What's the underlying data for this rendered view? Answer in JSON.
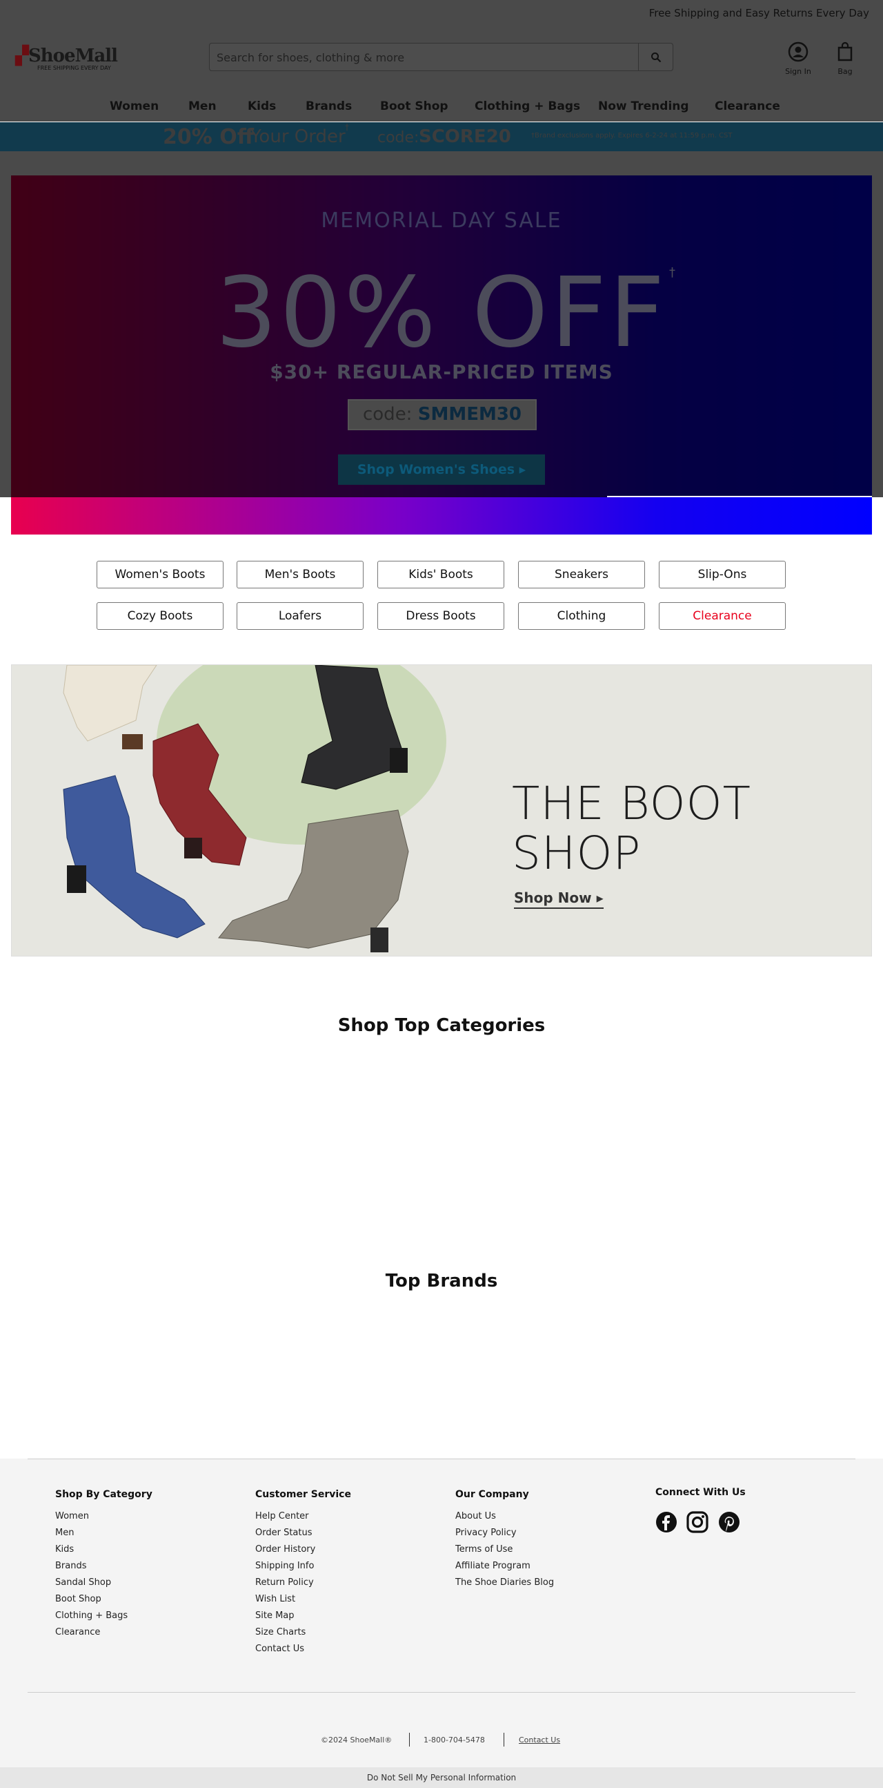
{
  "topbar": {
    "shipping_text": "Free Shipping and Easy Returns Every Day"
  },
  "header": {
    "logo_text": "ShoeMall",
    "logo_tagline": "FREE SHIPPING EVERY DAY",
    "search_placeholder": "Search for shoes, clothing & more",
    "signin_label": "Sign In",
    "bag_label": "Bag"
  },
  "nav": {
    "items": [
      "Women",
      "Men",
      "Kids",
      "Brands",
      "Boot Shop",
      "Clothing + Bags",
      "Now Trending",
      "Clearance"
    ]
  },
  "promo": {
    "amount": "20% Off",
    "your_order": "Your Order",
    "dagger": "†",
    "code_label": "code:",
    "code_value": "SCORE20",
    "exclusions": "†Brand exclusions apply. Expires 6-2-24 at 11:59 p.m. CST"
  },
  "hero": {
    "headline": "MEMORIAL DAY SALE",
    "discount": "30% OFF",
    "dagger": "†",
    "subline": "$30+ REGULAR-PRICED ITEMS",
    "code_label": "code:",
    "code_value": "SMMEM30",
    "cta": "Shop Women's Shoes ▸"
  },
  "quick_links": {
    "row1": [
      "Women's Boots",
      "Men's Boots",
      "Kids' Boots",
      "Sneakers",
      "Slip-Ons"
    ],
    "row2": [
      "Cozy Boots",
      "Loafers",
      "Dress Boots",
      "Clothing",
      "Clearance"
    ]
  },
  "boot_shop": {
    "title_line1": "THE BOOT",
    "title_line2": "SHOP",
    "cta": "Shop Now ▸"
  },
  "sections": {
    "top_categories": "Shop Top Categories",
    "top_brands": "Top Brands"
  },
  "footer": {
    "shop_by_category": {
      "title": "Shop By Category",
      "links": [
        "Women",
        "Men",
        "Kids",
        "Brands",
        "Sandal Shop",
        "Boot Shop",
        "Clothing + Bags",
        "Clearance"
      ]
    },
    "customer_service": {
      "title": "Customer Service",
      "links": [
        "Help Center",
        "Order Status",
        "Order History",
        "Shipping Info",
        "Return Policy",
        "Wish List",
        "Site Map",
        "Size Charts",
        "Contact Us"
      ]
    },
    "our_company": {
      "title": "Our Company",
      "links": [
        "About Us",
        "Privacy Policy",
        "Terms of Use",
        "Affiliate Program",
        "The Shoe Diaries Blog"
      ]
    },
    "connect": {
      "title": "Connect With Us",
      "icons": [
        "facebook-icon",
        "instagram-icon",
        "pinterest-icon"
      ]
    },
    "copyright": "©2024 ShoeMall®",
    "phone": "1-800-704-5478",
    "contact": "Contact Us",
    "do_not_sell": "Do Not Sell My Personal Information"
  },
  "colors": {
    "accent_red": "#e8001c",
    "promo_bar": "#113a4d",
    "footer_bg": "#f4f4f4"
  }
}
